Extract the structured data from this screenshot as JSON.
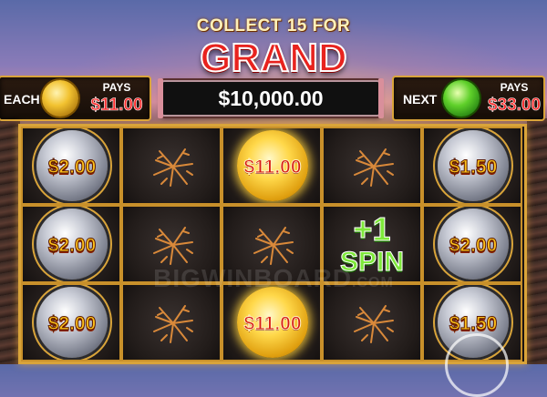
{
  "header": {
    "collect_text": "COLLECT 15 FOR",
    "jackpot_name": "GRAND",
    "jackpot_value": "$10,000.00"
  },
  "left_panel": {
    "label": "EACH",
    "pays_label": "PAYS",
    "pays_value": "$11.00",
    "coin_icon": "gold-coin-icon"
  },
  "right_panel": {
    "label": "NEXT",
    "pays_label": "PAYS",
    "pays_value": "$33.00",
    "coin_icon": "green-coin-icon"
  },
  "grid": {
    "rows": [
      [
        {
          "type": "silver",
          "value": "$2.00"
        },
        {
          "type": "crack"
        },
        {
          "type": "gold",
          "value": "$11.00"
        },
        {
          "type": "crack"
        },
        {
          "type": "silver",
          "value": "$1.50"
        }
      ],
      [
        {
          "type": "silver",
          "value": "$2.00"
        },
        {
          "type": "crack"
        },
        {
          "type": "crack"
        },
        {
          "type": "spin",
          "plus": "+1",
          "word": "SPIN"
        },
        {
          "type": "silver",
          "value": "$2.00"
        }
      ],
      [
        {
          "type": "silver",
          "value": "$2.00"
        },
        {
          "type": "crack"
        },
        {
          "type": "gold",
          "value": "$11.00"
        },
        {
          "type": "crack"
        },
        {
          "type": "silver",
          "value": "$1.50"
        }
      ]
    ]
  },
  "watermark": {
    "main": "BIGWINBOARD",
    "suffix": ".COM"
  },
  "colors": {
    "frame_gold": "#d9a43a",
    "grand_red": "#e8231e",
    "pays_red": "#ff2a2a",
    "spin_green": "#7ee83a"
  }
}
